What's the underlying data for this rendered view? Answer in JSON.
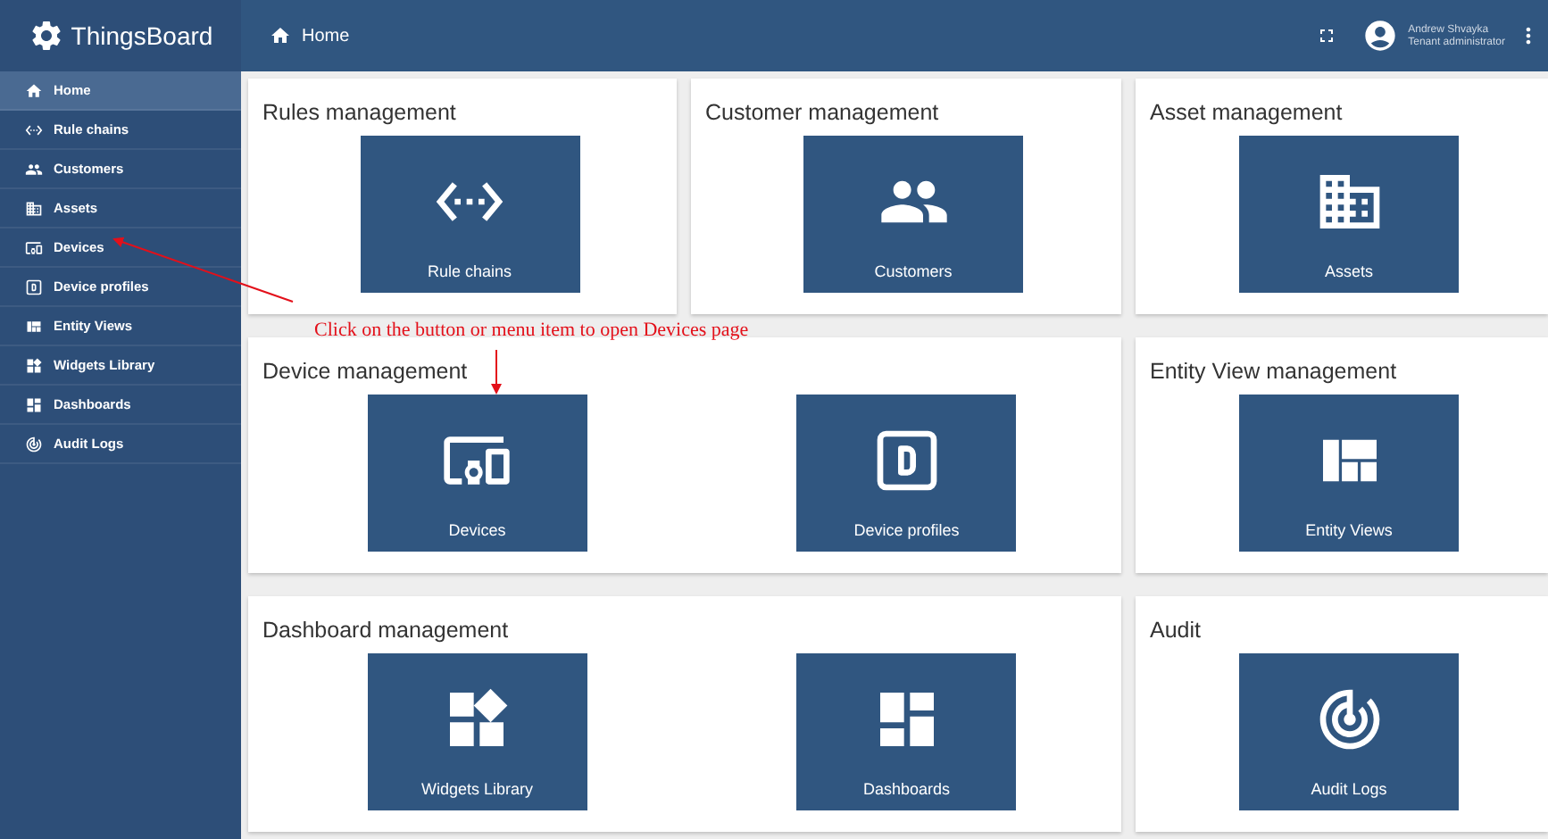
{
  "app": {
    "name": "ThingsBoard"
  },
  "sidebar": {
    "items": [
      {
        "label": "Home",
        "kind": "home",
        "selected": true
      },
      {
        "label": "Rule chains",
        "kind": "rules",
        "selected": false
      },
      {
        "label": "Customers",
        "kind": "customers",
        "selected": false
      },
      {
        "label": "Assets",
        "kind": "assets",
        "selected": false
      },
      {
        "label": "Devices",
        "kind": "devices",
        "selected": false
      },
      {
        "label": "Device profiles",
        "kind": "profiles",
        "selected": false
      },
      {
        "label": "Entity Views",
        "kind": "views",
        "selected": false
      },
      {
        "label": "Widgets Library",
        "kind": "widgets",
        "selected": false
      },
      {
        "label": "Dashboards",
        "kind": "dashboards",
        "selected": false
      },
      {
        "label": "Audit Logs",
        "kind": "audit",
        "selected": false
      }
    ]
  },
  "header": {
    "breadcrumb": "Home",
    "user": {
      "name": "Andrew Shvayka",
      "role": "Tenant administrator"
    }
  },
  "sections": [
    {
      "title": "Rules management",
      "wide": false,
      "tiles": [
        {
          "label": "Rule chains",
          "kind": "rules"
        }
      ]
    },
    {
      "title": "Customer management",
      "wide": false,
      "tiles": [
        {
          "label": "Customers",
          "kind": "customers"
        }
      ]
    },
    {
      "title": "Asset management",
      "wide": false,
      "tiles": [
        {
          "label": "Assets",
          "kind": "assets"
        }
      ]
    },
    {
      "title": "Device management",
      "wide": true,
      "tiles": [
        {
          "label": "Devices",
          "kind": "devices"
        },
        {
          "label": "Device profiles",
          "kind": "profiles"
        }
      ]
    },
    {
      "title": "Entity View management",
      "wide": false,
      "tiles": [
        {
          "label": "Entity Views",
          "kind": "views"
        }
      ]
    },
    {
      "title": "Dashboard management",
      "wide": true,
      "tiles": [
        {
          "label": "Widgets Library",
          "kind": "widgets"
        },
        {
          "label": "Dashboards",
          "kind": "dashboards"
        }
      ]
    },
    {
      "title": "Audit",
      "wide": false,
      "tiles": [
        {
          "label": "Audit Logs",
          "kind": "audit"
        }
      ]
    }
  ],
  "annotation": {
    "text": "Click on the button or menu item to open Devices page"
  }
}
